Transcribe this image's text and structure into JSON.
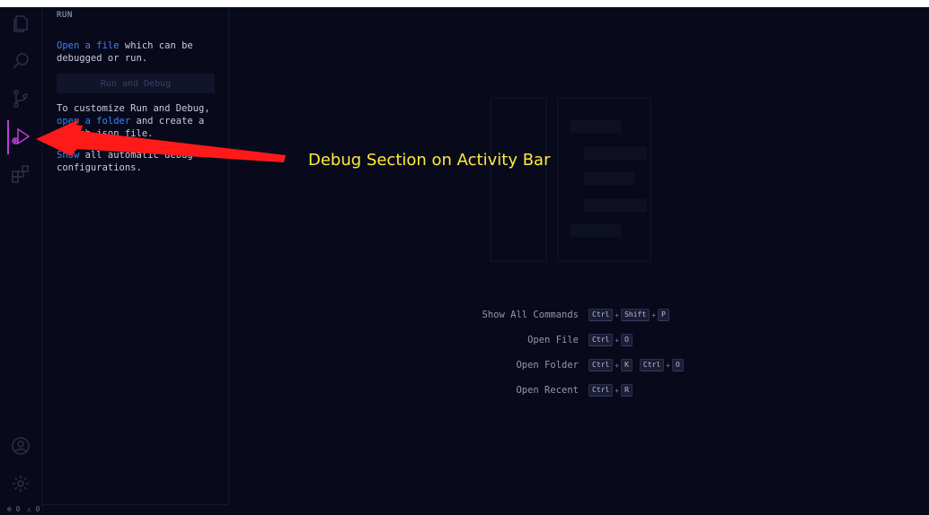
{
  "sidebar": {
    "title": "RUN",
    "open_file_link": "Open a file",
    "open_file_rest": " which can be debugged or run.",
    "run_button": "Run and Debug",
    "customize_text": "To customize Run and Debug,",
    "open_folder_link": "open a folder",
    "customize_rest": " and create a launch.json file.",
    "show_link": "Show",
    "show_rest": " all automatic debug configurations."
  },
  "shortcuts": [
    {
      "label": "Show All Commands",
      "keys": [
        "Ctrl",
        "Shift",
        "P"
      ]
    },
    {
      "label": "Open File",
      "keys": [
        "Ctrl",
        "O"
      ]
    },
    {
      "label": "Open Folder",
      "keys": [
        "Ctrl",
        "K"
      ],
      "keys2": [
        "Ctrl",
        "O"
      ]
    },
    {
      "label": "Open Recent",
      "keys": [
        "Ctrl",
        "R"
      ]
    }
  ],
  "status": {
    "errors": "0",
    "warnings": "0"
  },
  "annotation": {
    "text": "Debug Section on Activity Bar",
    "color": "#ffeb3b",
    "arrow_color": "#ff1a1a"
  },
  "icons": [
    "files-icon",
    "search-icon",
    "source-control-icon",
    "run-debug-icon",
    "extensions-icon",
    "account-icon",
    "settings-gear-icon"
  ],
  "colors": {
    "background": "#080a1c",
    "link": "#3b82f6",
    "active_indicator": "#c13bd9"
  }
}
